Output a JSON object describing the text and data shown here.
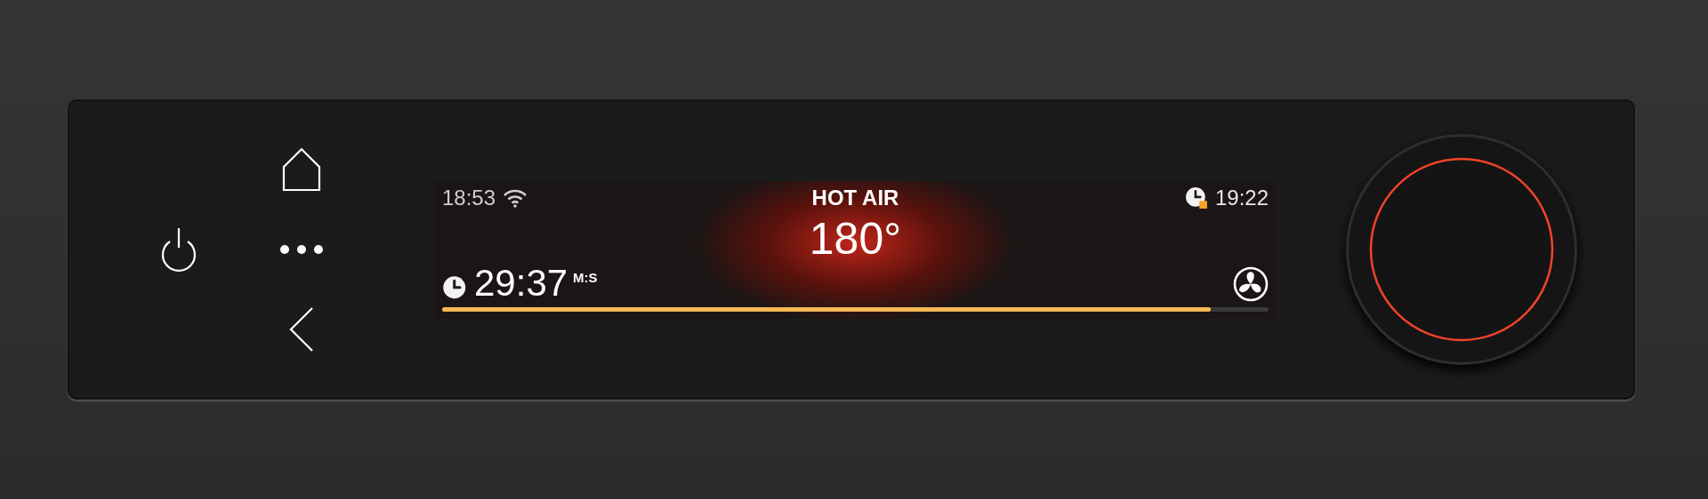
{
  "display": {
    "clock": "18:53",
    "mode": "HOT AIR",
    "end_time": "19:22",
    "temperature": "180°",
    "timer": "29:37",
    "timer_unit": "M:S",
    "progress": {
      "level": 0.93
    }
  }
}
